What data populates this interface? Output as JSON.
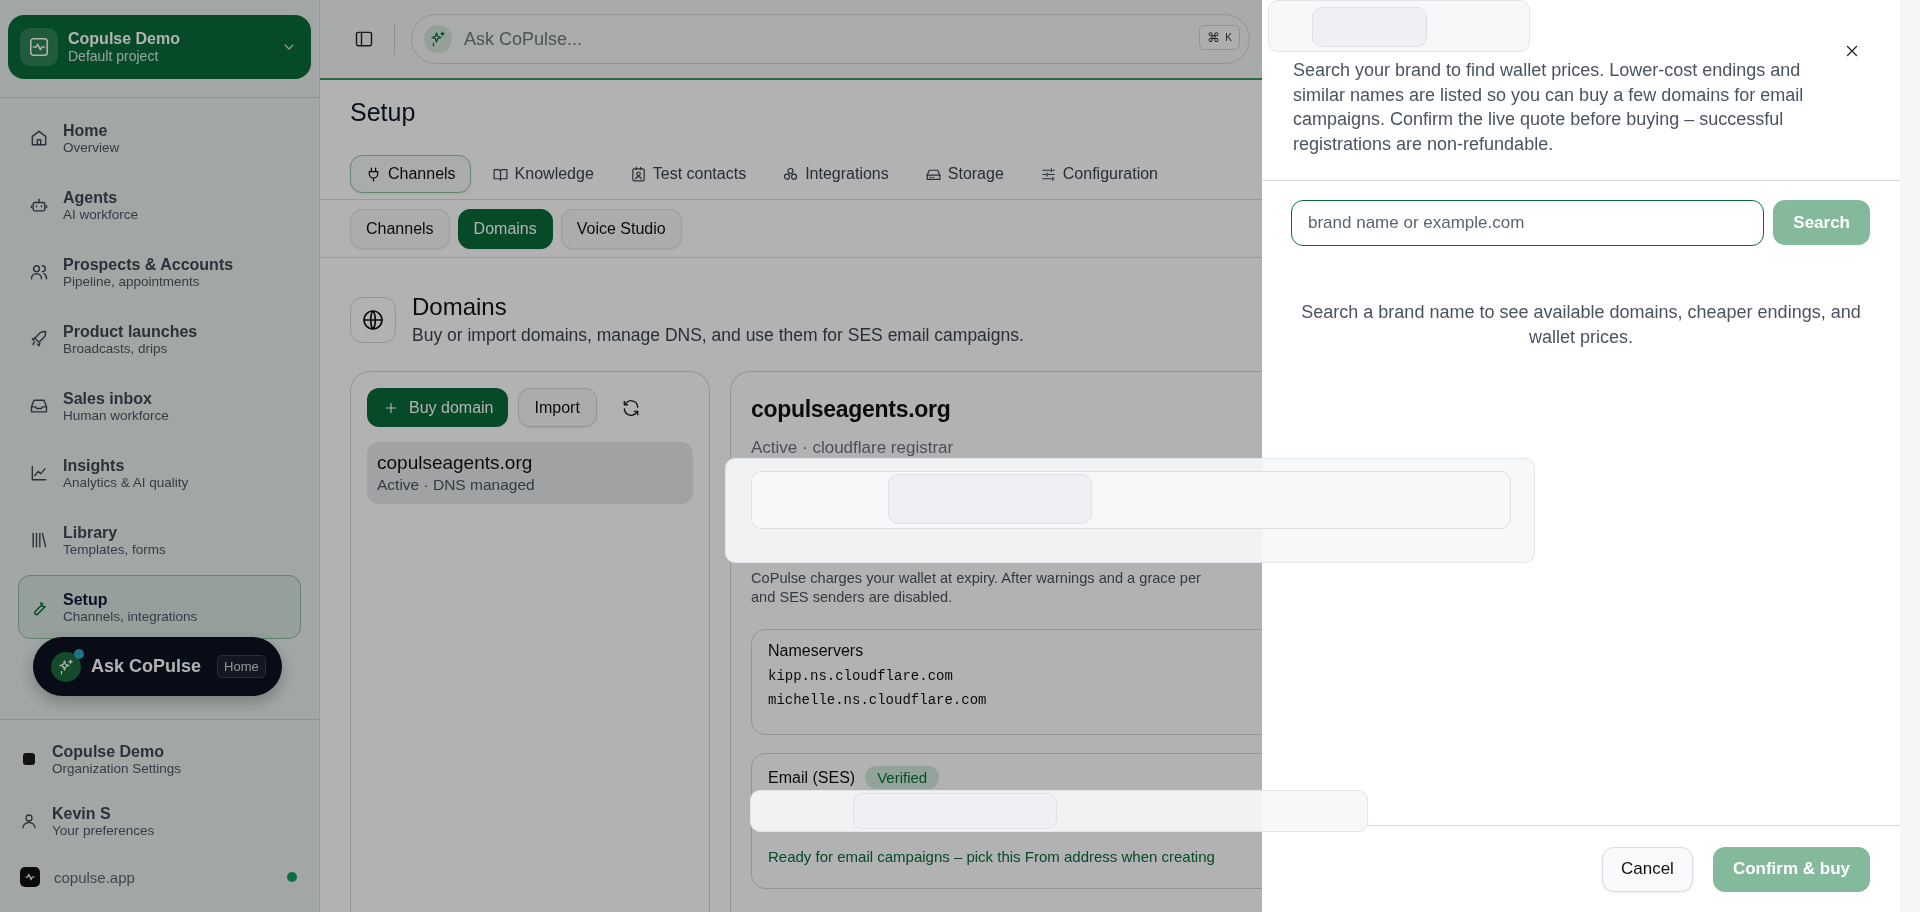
{
  "project_switcher": {
    "name": "Copulse Demo",
    "subtitle": "Default project"
  },
  "sidebar": {
    "items": [
      {
        "title": "Home",
        "subtitle": "Overview",
        "selected": false
      },
      {
        "title": "Agents",
        "subtitle": "AI workforce",
        "selected": false
      },
      {
        "title": "Prospects & Accounts",
        "subtitle": "Pipeline, appointments",
        "selected": false
      },
      {
        "title": "Product launches",
        "subtitle": "Broadcasts, drips",
        "selected": false
      },
      {
        "title": "Sales inbox",
        "subtitle": "Human workforce",
        "selected": false
      },
      {
        "title": "Insights",
        "subtitle": "Analytics & AI quality",
        "selected": false
      },
      {
        "title": "Library",
        "subtitle": "Templates, forms",
        "selected": false
      },
      {
        "title": "Setup",
        "subtitle": "Channels, integrations",
        "selected": true
      }
    ],
    "footer": [
      {
        "title": "Copulse Demo",
        "subtitle": "Organization Settings"
      },
      {
        "title": "Kevin S",
        "subtitle": "Your preferences"
      }
    ],
    "site": {
      "label": "copulse.app",
      "online": true
    }
  },
  "ask_pill": {
    "label": "Ask CoPulse",
    "badge": "Home"
  },
  "top_bar": {
    "search": {
      "placeholder": "Ask CoPulse..."
    },
    "shortcut": [
      "⌘",
      "K"
    ]
  },
  "page": {
    "title": "Setup",
    "tabs": [
      {
        "label": "Channels",
        "selected": true
      },
      {
        "label": "Knowledge",
        "selected": false
      },
      {
        "label": "Test contacts",
        "selected": false
      },
      {
        "label": "Integrations",
        "selected": false
      },
      {
        "label": "Storage",
        "selected": false
      },
      {
        "label": "Configuration",
        "selected": false
      }
    ],
    "subtabs": [
      {
        "label": "Channels",
        "selected": false
      },
      {
        "label": "Domains",
        "selected": true
      },
      {
        "label": "Voice Studio",
        "selected": false
      }
    ],
    "section": {
      "title": "Domains",
      "subtitle": "Buy or import domains, manage DNS, and use them for SES email campaigns."
    },
    "domain_list": {
      "buy_button": "Buy domain",
      "import_button": "Import",
      "items": [
        {
          "name": "copulseagents.org",
          "status": "Active · DNS managed",
          "selected": true
        }
      ]
    },
    "detail": {
      "title": "copulseagents.org",
      "status": "Active · cloudflare registrar",
      "note_lines": [
        "CoPulse charges your wallet at expiry. After warnings and a grace per",
        "and SES senders are disabled."
      ],
      "nameservers": {
        "title": "Nameservers",
        "values": [
          "kipp.ns.cloudflare.com",
          "michelle.ns.cloudflare.com"
        ]
      },
      "email": {
        "title": "Email (SES)",
        "badge": "Verified",
        "ready": "Ready for email campaigns – pick this From address when creating"
      }
    }
  },
  "drawer": {
    "description": "Search your brand to find wallet prices. Lower-cost endings and similar names are listed so you can buy a few domains for email campaigns. Confirm the live quote before buying – successful registrations are non-refundable.",
    "search": {
      "placeholder": "brand name or example.com",
      "button": {
        "label": "Search",
        "disabled": true
      }
    },
    "hint": "Search a brand name to see available domains, cheaper endings, and wallet prices.",
    "buttons": [
      {
        "label": "Cancel",
        "kind": "secondary",
        "disabled": false
      },
      {
        "label": "Confirm & buy",
        "kind": "primary",
        "disabled": true
      }
    ]
  }
}
